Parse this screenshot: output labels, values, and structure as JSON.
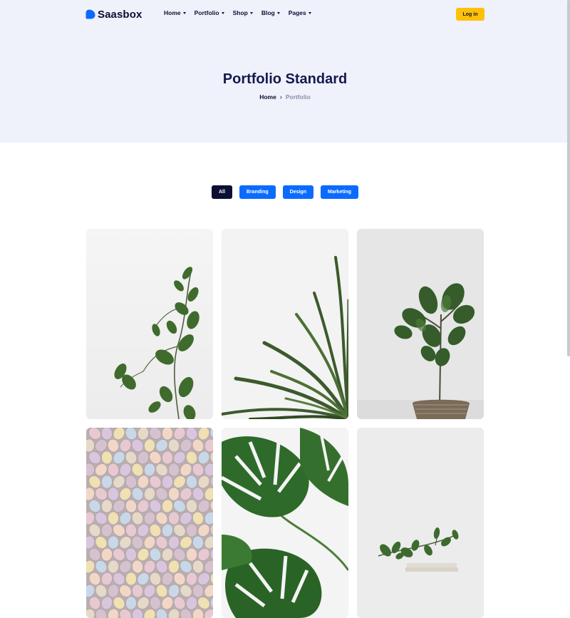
{
  "brand": {
    "name": "Saasbox",
    "accent_color": "#0b6bff",
    "logo_icon": "saasbox-logo-icon"
  },
  "nav": {
    "items": [
      {
        "label": "Home",
        "icon": "caret-down-icon"
      },
      {
        "label": "Portfolio",
        "icon": "caret-down-icon"
      },
      {
        "label": "Shop",
        "icon": "caret-down-icon"
      },
      {
        "label": "Blog",
        "icon": "caret-down-icon"
      },
      {
        "label": "Pages",
        "icon": "caret-down-icon"
      }
    ],
    "login_label": "Log in",
    "login_color": "#ffc107"
  },
  "hero": {
    "title": "Portfolio Standard",
    "background_color": "#eff1fb",
    "breadcrumb": {
      "home": "Home",
      "separator_icon": "chevron-right-icon",
      "current": "Portfolio"
    }
  },
  "filters": {
    "items": [
      {
        "label": "All",
        "active": true
      },
      {
        "label": "Branding",
        "active": false
      },
      {
        "label": "Design",
        "active": false
      },
      {
        "label": "Marketing",
        "active": false
      }
    ],
    "active_color": "#0b1033",
    "inactive_color": "#0b6bff"
  },
  "portfolio": {
    "items": [
      {
        "image": "eucalyptus-branch-photo"
      },
      {
        "image": "spiky-plant-leaves-photo"
      },
      {
        "image": "potted-fig-tree-photo"
      },
      {
        "image": "speckled-pastel-eggs-photo"
      },
      {
        "image": "monstera-leaves-photo"
      },
      {
        "image": "branch-on-books-photo"
      }
    ]
  }
}
